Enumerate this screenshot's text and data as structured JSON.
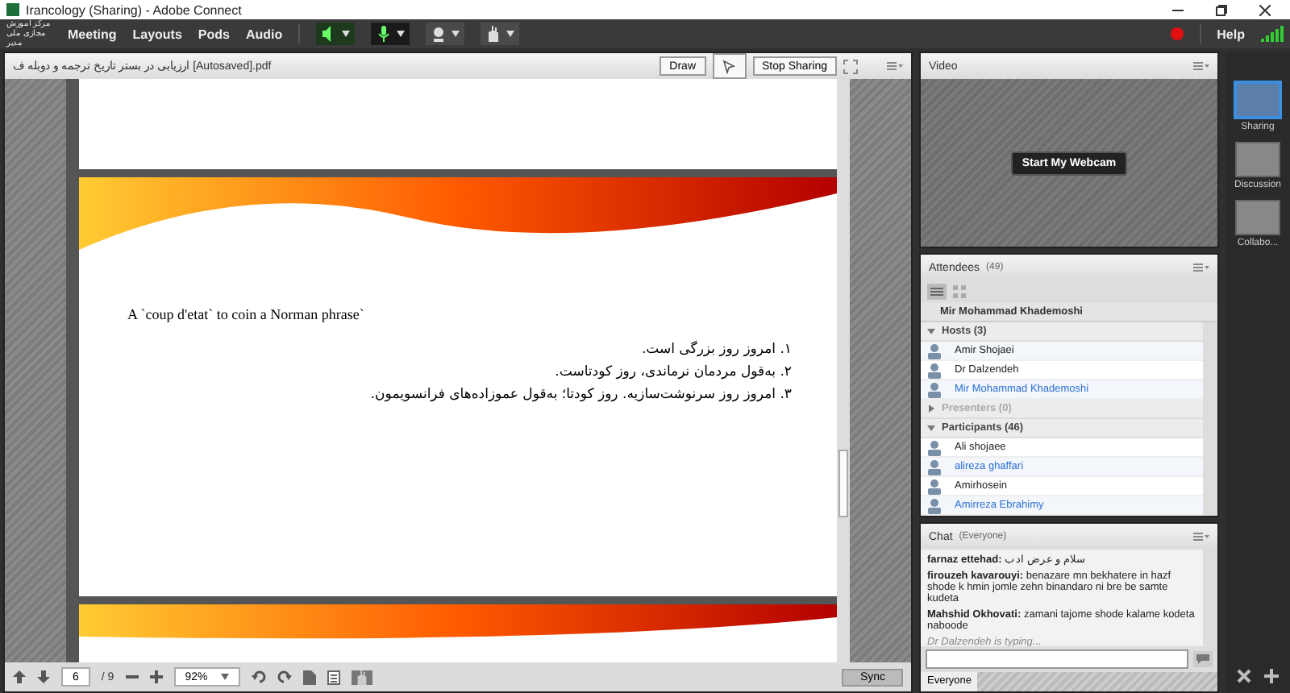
{
  "window": {
    "title": "Irancology (Sharing) - Adobe Connect"
  },
  "menu": {
    "logo_lines": [
      "مرکز آموزش",
      "مجازی ملی مدیر"
    ],
    "items": [
      "Meeting",
      "Layouts",
      "Pods",
      "Audio"
    ],
    "help": "Help",
    "recording": true
  },
  "share_pod": {
    "title": "ارزیابی در بستر تاریخ ترجمه و دوبله ف [Autosaved].pdf",
    "buttons": [
      "Draw",
      "Stop Sharing"
    ],
    "slide": {
      "heading": "A `coup d'etat` to coin a Norman phrase`",
      "lines": [
        "۱. امروز روز بزرگی است.",
        "۲. به‌قول مردمان نرماندی، روز کودتاست.",
        "۳. امروز روز سرنوشت‌سازیه. روز کودتا؛ به‌قول عموزاده‌های فرانسویمون."
      ]
    },
    "toolbar": {
      "page": "6",
      "total": "/ 9",
      "zoom": "92%",
      "sync": "Sync"
    }
  },
  "video": {
    "title": "Video",
    "button": "Start My Webcam"
  },
  "attendees": {
    "title": "Attendees",
    "count": "(49)",
    "me": "Mir Mohammad Khademoshi",
    "groups": [
      {
        "label": "Hosts (3)",
        "expanded": true,
        "people": [
          {
            "name": "Amir Shojaei",
            "color": "#222222"
          },
          {
            "name": "Dr Dalzendeh",
            "color": "#222222"
          },
          {
            "name": "Mir Mohammad Khademoshi",
            "color": "#2a6fd6"
          }
        ]
      },
      {
        "label": "Presenters (0)",
        "expanded": false
      },
      {
        "label": "Participants (46)",
        "expanded": true,
        "people": [
          {
            "name": "Ali shojaee",
            "color": "#222222"
          },
          {
            "name": "alireza ghaffari",
            "color": "#2a6fd6"
          },
          {
            "name": "Amirhosein",
            "color": "#222222"
          },
          {
            "name": "Amirreza Ebrahimy",
            "color": "#2a6fd6"
          }
        ]
      }
    ]
  },
  "chat": {
    "title": "Chat",
    "scope": "(Everyone)",
    "messages": [
      {
        "sender": "farnaz ettehad:",
        "text": "سلام و عرض ادب"
      },
      {
        "sender": "firouzeh kavarouyi:",
        "text": "benazare mn bekhatere in hazf shode k hmin jomle zehn binandaro ni bre be samte kudeta"
      },
      {
        "sender": "Mahshid Okhovati:",
        "text": "zamani tajome shode kalame kodeta naboode"
      }
    ],
    "typing": "Dr Dalzendeh is typing...",
    "tab": "Everyone"
  },
  "layouts": [
    {
      "label": "Sharing",
      "selected": true
    },
    {
      "label": "Discussion",
      "selected": false
    },
    {
      "label": "Collabo...",
      "selected": false
    }
  ]
}
